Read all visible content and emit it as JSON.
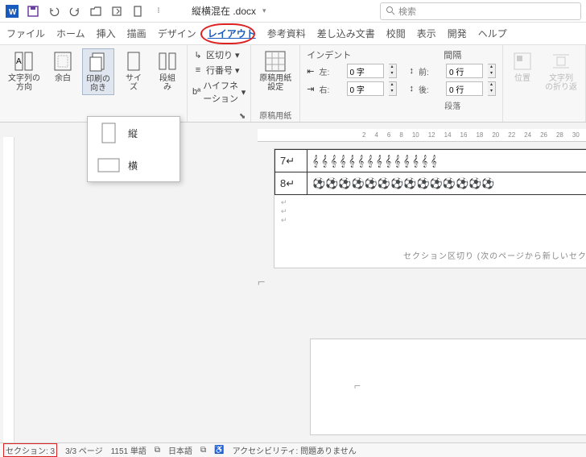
{
  "title": {
    "filename": "縦横混在 .docx"
  },
  "search": {
    "placeholder": "検索"
  },
  "menu": {
    "file": "ファイル",
    "home": "ホーム",
    "insert": "挿入",
    "draw": "描画",
    "design": "デザイン",
    "layout": "レイアウト",
    "reference": "参考資料",
    "mailmerge": "差し込み文書",
    "review": "校閲",
    "view": "表示",
    "developer": "開発",
    "help": "ヘルプ"
  },
  "ribbon": {
    "textdir": "文字列の\n方向",
    "margin": "余白",
    "orient": "印刷の\n向き",
    "size": "サイズ",
    "columns": "段組み",
    "breaks": "区切り",
    "linenum": "行番号",
    "hyphen": "ハイフネーション",
    "genkou1": "原稿用紙\n設定",
    "genkou_grp": "原稿用紙",
    "indent_title": "インデント",
    "spacing_title": "間隔",
    "indent_left_lbl": "左:",
    "indent_right_lbl": "右:",
    "indent_left_val": "0 字",
    "indent_right_val": "0 字",
    "spacing_before_lbl": "前:",
    "spacing_after_lbl": "後:",
    "spacing_before_val": "0 行",
    "spacing_after_val": "0 行",
    "para_grp": "段落",
    "position": "位置",
    "wrap": "文字列\nの折り返"
  },
  "orient_menu": {
    "portrait": "縦",
    "landscape": "横"
  },
  "ruler": [
    "2",
    "4",
    "6",
    "8",
    "10",
    "12",
    "14",
    "16",
    "18",
    "20",
    "22",
    "24",
    "26",
    "28",
    "30"
  ],
  "table": {
    "row1_num": "7",
    "row2_num": "8"
  },
  "section_break": "セクション区切り (次のページから新しいセク",
  "status": {
    "section": "セクション: 3",
    "page": "3/3 ページ",
    "words": "1151 単語",
    "lang": "日本語",
    "access": "アクセシビリティ: 問題ありません"
  }
}
